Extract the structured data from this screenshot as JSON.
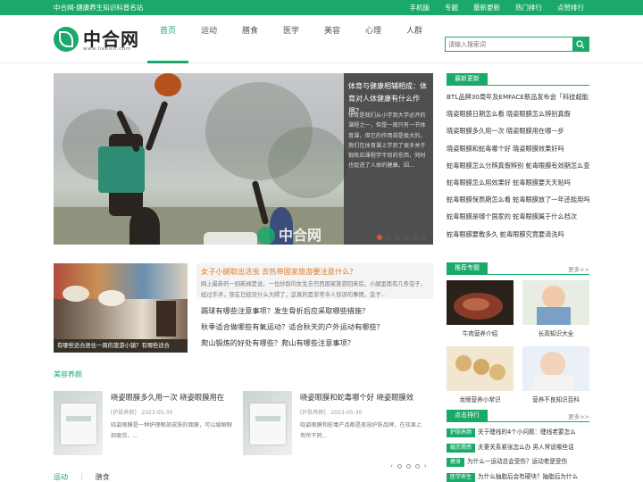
{
  "topbar": {
    "site_name": "中合网-健康养生知识科普名站",
    "links": [
      "手机版",
      "专题",
      "最新更新",
      "热门排行",
      "点赞排行"
    ]
  },
  "logo": {
    "name": "中合网",
    "url": "www.heelcn.com"
  },
  "nav": {
    "items": [
      "首页",
      "运动",
      "膳食",
      "医学",
      "美容",
      "心理",
      "人群"
    ],
    "active_index": 0
  },
  "search": {
    "placeholder": "请输入搜索词"
  },
  "slider": {
    "title": "体育与健康相辅相成：体育对人体健康有什么作用？",
    "description": "体育是我们从小学到大学必开的课程之一，但是一周只有一节体育课，但它的作用却是极大的。我们在体育课上学到了很多关于锻炼应课程学不到的东西，同时也促进了人体的健康。因...",
    "watermark": "中合网",
    "dot_count": 6,
    "active_dot": 0
  },
  "latest": {
    "heading": "最新更新",
    "items": [
      "BTL品牌30周年及EMFACE新品发布会「科技超能",
      "晓姿眼膜日期怎么看 晓姿眼膜怎么辨别真假",
      "晓姿眼膜多久用一次 晓姿眼膜用在哪一步",
      "晓姿眼膜和蛇毒哪个好 晓姿眼膜效果好吗",
      "蛇毒眼膜怎么分辨真假辨别 蛇毒眼膜有效期怎么查",
      "蛇毒眼膜怎么用效果好 蛇毒眼膜要天天贴吗",
      "蛇毒眼膜保质期怎么看 蛇毒眼膜放了一年还能用吗",
      "蛇毒眼膜是哪个国家的 蛇毒眼膜属于什么档次",
      "蛇毒眼膜要敷多久 蛇毒眼膜究竟要清洗吗"
    ]
  },
  "feature": {
    "image_caption": "有哪些适合居住一周的旅游小镇？有哪些适合",
    "headline": "女子小腿取出活虫 去热带国家旅游要注意什么？",
    "headline_desc": "网上最新的一则新闻是说，一位妙龄的女生去巴西国家旅游回来后，小腿里面有几条虫子，经过手术，现在已经没什么大碍了，这真的是非常令人惊讶的事情，虫子...",
    "links": [
      "踢球有哪些注意事项？发生骨折后应采取哪些措施？",
      "秋季适合做哪些有氧运动？适合秋天的户外运动有哪些？",
      "爬山锻炼的好处有哪些？爬山有哪些注意事项？"
    ]
  },
  "beauty": {
    "heading": "美容养颜",
    "cards": [
      {
        "title": "晓姿眼膜多久用一次 晓姿眼膜用在",
        "category": "[护肤养颜]",
        "date": "2023-05-30",
        "desc": "晓姿眼膜是一种护理眼部皮肤的面膜，可以缓解眼部疲劳、..."
      },
      {
        "title": "晓姿眼膜和蛇毒哪个好 晓姿眼膜效",
        "category": "[护肤养颜]",
        "date": "2023-05-30",
        "desc": "晓姿眼膜和蛇毒产品都是美容护肤品牌，在效果上有所不同..."
      }
    ]
  },
  "bottom_tabs": [
    "运动",
    "膳食"
  ],
  "topics": {
    "heading": "推荐专题",
    "more": "更多>>",
    "items": [
      "牛肉营养介绍",
      "长高知识大全",
      "龙眼营养小常识",
      "营养不良知识百科"
    ]
  },
  "hot": {
    "heading": "点击排行",
    "more": "更多>>",
    "items": [
      {
        "badge": "护肤养颜",
        "text": "关于睫线的4个小问题：睫线老要怎么"
      },
      {
        "badge": "婚恋情感",
        "text": "夫妻关系紧张怎么办 男人常说哪些话"
      },
      {
        "badge": "健身",
        "text": "为什么一运动总会受伤？运动老是受伤"
      },
      {
        "badge": "医学养生",
        "text": "为什么抽脂后会有硬块？抽脂后为什么"
      }
    ]
  }
}
